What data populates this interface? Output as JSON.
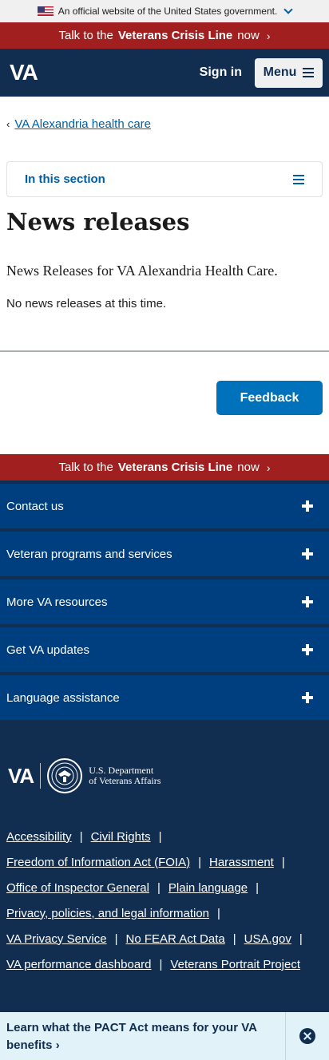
{
  "gov_banner": {
    "text": "An official website of the United States government."
  },
  "crisis_line": {
    "prefix": "Talk to the",
    "bold": "Veterans Crisis Line",
    "suffix": "now",
    "arrow": "›"
  },
  "header": {
    "logo": "VA",
    "sign_in": "Sign in",
    "menu": "Menu"
  },
  "breadcrumb": {
    "back_glyph": "‹",
    "label": "VA Alexandria health care"
  },
  "section_nav": {
    "label": "In this section"
  },
  "page": {
    "title": "News releases",
    "intro": "News Releases for VA Alexandria Health Care.",
    "empty": "No news releases at this time."
  },
  "feedback": {
    "label": "Feedback"
  },
  "footer": {
    "accordions": [
      {
        "label": "Contact us"
      },
      {
        "label": "Veteran programs and services"
      },
      {
        "label": "More VA resources"
      },
      {
        "label": "Get VA updates"
      },
      {
        "label": "Language assistance"
      }
    ],
    "logo": {
      "va": "VA",
      "dept_line1": "U.S. Department",
      "dept_line2": "of Veterans Affairs"
    },
    "link_rows": [
      [
        "Accessibility",
        "Civil Rights"
      ],
      [
        "Freedom of Information Act (FOIA)",
        "Harassment"
      ],
      [
        "Office of Inspector General",
        "Plain language"
      ],
      [
        "Privacy, policies, and legal information"
      ],
      [
        "VA Privacy Service",
        "No FEAR Act Data",
        "USA.gov"
      ],
      [
        "VA performance dashboard",
        "Veterans Portrait Project"
      ]
    ],
    "separator": "|"
  },
  "pact_banner": {
    "line1": "Learn what the PACT Act means for your VA",
    "line2": "benefits",
    "arrow": "›"
  },
  "colors": {
    "navy": "#112e51",
    "crisis_red": "#a1201f",
    "link_blue": "#005ea2",
    "button_blue": "#0071bb",
    "accordion_blue": "#003f7f"
  },
  "icons": [
    "us-flag-icon",
    "chevron-down-icon",
    "hamburger-icon",
    "plus-icon",
    "va-seal-icon",
    "close-icon"
  ]
}
